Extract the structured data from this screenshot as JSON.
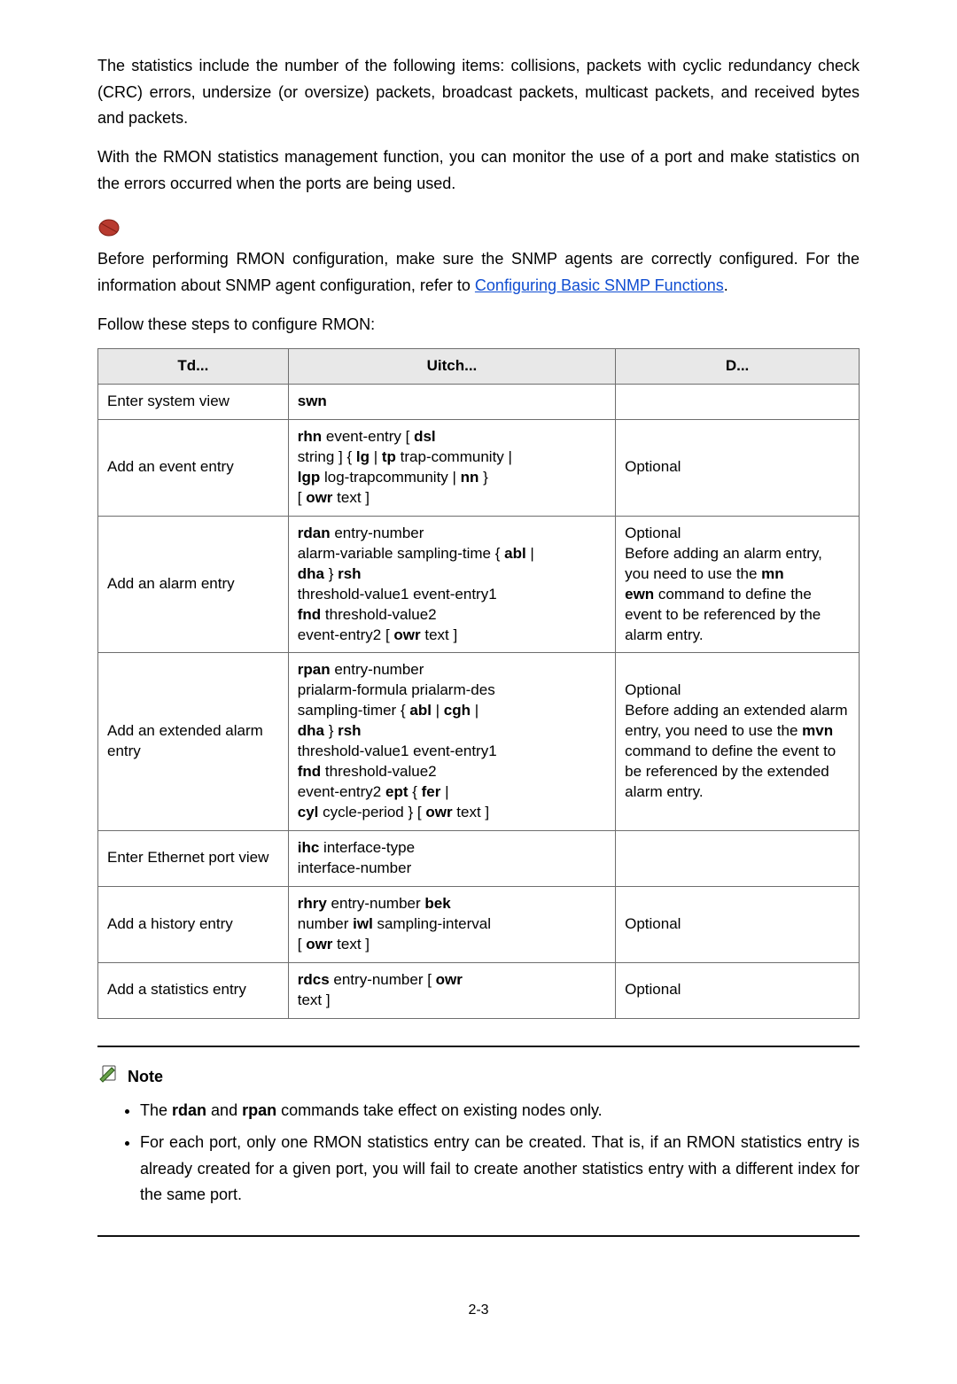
{
  "intro": {
    "p1": "The statistics include the number of the following items: collisions, packets with cyclic redundancy check (CRC) errors, undersize (or oversize) packets, broadcast packets, multicast packets, and received bytes and packets.",
    "p2": "With the RMON statistics management function, you can monitor the use of a port and make statistics on the errors occurred when the ports are being used."
  },
  "caution": {
    "p_before": "Before performing RMON configuration, make sure the SNMP agents are correctly configured. For the information about SNMP agent configuration, refer to ",
    "link": "Configuring Basic SNMP Functions",
    "p_after": "."
  },
  "follow": "Follow these steps to configure RMON:",
  "table": {
    "headers": {
      "todo": "Td...",
      "cmd": "Uitch...",
      "desc": "D..."
    },
    "rows": [
      {
        "todo": "Enter system view",
        "cmd_lines": [
          [
            {
              "b": "swn"
            }
          ]
        ],
        "desc_lines": []
      },
      {
        "todo": "Add an event entry",
        "cmd_lines": [
          [
            {
              "b": "rhn"
            },
            {
              "t": " event-entry [ "
            },
            {
              "b": "dsl"
            }
          ],
          [
            {
              "t": "string ] { "
            },
            {
              "b": "lg"
            },
            {
              "t": " | "
            },
            {
              "b": "tp"
            },
            {
              "t": " trap-community |"
            }
          ],
          [
            {
              "b": "lgp"
            },
            {
              "t": " log-trapcommunity | "
            },
            {
              "b": "nn"
            },
            {
              "t": " }"
            }
          ],
          [
            {
              "t": "[ "
            },
            {
              "b": "owr"
            },
            {
              "t": " text ]"
            }
          ]
        ],
        "desc_lines": [
          [
            {
              "t": "Optional"
            }
          ]
        ]
      },
      {
        "todo": "Add an alarm entry",
        "cmd_lines": [
          [
            {
              "b": "rdan"
            },
            {
              "t": " entry-number"
            }
          ],
          [
            {
              "t": "alarm-variable sampling-time { "
            },
            {
              "b": "abl"
            },
            {
              "t": " |"
            }
          ],
          [
            {
              "b": "dha"
            },
            {
              "t": " } "
            },
            {
              "b": "rsh"
            }
          ],
          [
            {
              "t": "threshold-value1 event-entry1"
            }
          ],
          [
            {
              "b": "fnd"
            },
            {
              "t": " threshold-value2"
            }
          ],
          [
            {
              "t": "event-entry2 [ "
            },
            {
              "b": "owr"
            },
            {
              "t": " text ]"
            }
          ]
        ],
        "desc_lines": [
          [
            {
              "t": "Optional"
            }
          ],
          [
            {
              "t": "Before adding an alarm entry, you need to use the "
            },
            {
              "b": "mn"
            }
          ],
          [
            {
              "b": "ewn"
            },
            {
              "t": " command to define the event to be referenced by the alarm entry."
            }
          ]
        ]
      },
      {
        "todo": "Add an extended alarm entry",
        "cmd_lines": [
          [
            {
              "b": "rpan"
            },
            {
              "t": " entry-number"
            }
          ],
          [
            {
              "t": "prialarm-formula prialarm-des"
            }
          ],
          [
            {
              "t": "sampling-timer { "
            },
            {
              "b": "abl"
            },
            {
              "t": " | "
            },
            {
              "b": "cgh"
            },
            {
              "t": " |"
            }
          ],
          [
            {
              "b": "dha"
            },
            {
              "t": " } "
            },
            {
              "b": "rsh"
            }
          ],
          [
            {
              "t": "threshold-value1 event-entry1"
            }
          ],
          [
            {
              "b": "fnd"
            },
            {
              "t": " threshold-value2"
            }
          ],
          [
            {
              "t": "event-entry2 "
            },
            {
              "b": "ept"
            },
            {
              "t": " { "
            },
            {
              "b": "fer"
            },
            {
              "t": " |"
            }
          ],
          [
            {
              "b": "cyl"
            },
            {
              "t": " cycle-period } [ "
            },
            {
              "b": "owr"
            },
            {
              "t": " text ]"
            }
          ]
        ],
        "desc_lines": [
          [
            {
              "t": "Optional"
            }
          ],
          [
            {
              "t": "Before adding an extended alarm entry, you need to use the "
            },
            {
              "b": "mvn"
            },
            {
              "t": " command to define the event to be referenced by the extended alarm entry."
            }
          ]
        ]
      },
      {
        "todo": "Enter Ethernet port view",
        "cmd_lines": [
          [
            {
              "b": "ihc"
            },
            {
              "t": " interface-type"
            }
          ],
          [
            {
              "t": "interface-number"
            }
          ]
        ],
        "desc_lines": []
      },
      {
        "todo": "Add a history entry",
        "cmd_lines": [
          [
            {
              "b": "rhry"
            },
            {
              "t": " entry-number "
            },
            {
              "b": "bek"
            }
          ],
          [
            {
              "t": "number "
            },
            {
              "b": "iwl"
            },
            {
              "t": " sampling-interval"
            }
          ],
          [
            {
              "t": "[ "
            },
            {
              "b": "owr"
            },
            {
              "t": " text ]"
            }
          ]
        ],
        "desc_lines": [
          [
            {
              "t": "Optional"
            }
          ]
        ]
      },
      {
        "todo": "Add a statistics entry",
        "cmd_lines": [
          [
            {
              "b": "rdcs"
            },
            {
              "t": " entry-number [ "
            },
            {
              "b": "owr"
            }
          ],
          [
            {
              "t": "text ]"
            }
          ]
        ],
        "desc_lines": [
          [
            {
              "t": "Optional"
            }
          ]
        ]
      }
    ]
  },
  "note": {
    "label": "Note",
    "bullets": [
      [
        {
          "t": "The "
        },
        {
          "b": "rdan"
        },
        {
          "t": " and "
        },
        {
          "b": "rpan"
        },
        {
          "t": " commands take effect on existing nodes only."
        }
      ],
      [
        {
          "t": "For each port, only one RMON statistics entry can be created. That is, if an RMON statistics entry is already created for a given port, you will fail to create another statistics entry with a different index for the same port."
        }
      ]
    ]
  },
  "page_number": "2-3"
}
